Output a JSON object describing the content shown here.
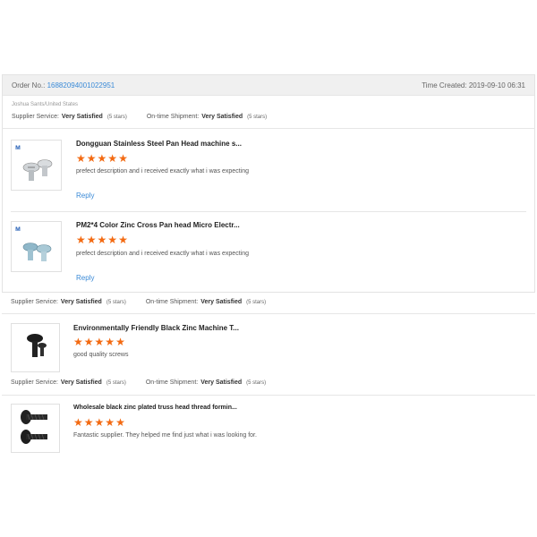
{
  "order": {
    "label": "Order No.:",
    "number": "16882094001022951",
    "time_created": "Time Created: 2019-09-10 06:31",
    "buyer": "Joshua Sants/United States"
  },
  "service": {
    "supplier_label": "Supplier Service:",
    "shipment_label": "On-time Shipment:",
    "rating": "Very Satisfied",
    "stars_note": "(5 stars)"
  },
  "reviews": [
    {
      "title": "Dongguan Stainless Steel Pan Head machine s...",
      "stars": 5,
      "comment": "prefect description and i received exactly what i was expecting",
      "reply": "Reply"
    },
    {
      "title": "PM2*4 Color Zinc Cross Pan head Micro Electr...",
      "stars": 5,
      "comment": "prefect description and i received exactly what i was expecting",
      "reply": "Reply"
    },
    {
      "title": "Environmentally Friendly Black Zinc Machine T...",
      "stars": 5,
      "comment": "good quality screws"
    },
    {
      "title": "Wholesale black zinc plated truss head thread formin...",
      "stars": 5,
      "comment": "Fantastic supplier. They helped me find just what i was looking for."
    }
  ],
  "colors": {
    "accent_link": "#3a8ad7",
    "star": "#f36a12"
  },
  "icons": {
    "star": "★"
  }
}
